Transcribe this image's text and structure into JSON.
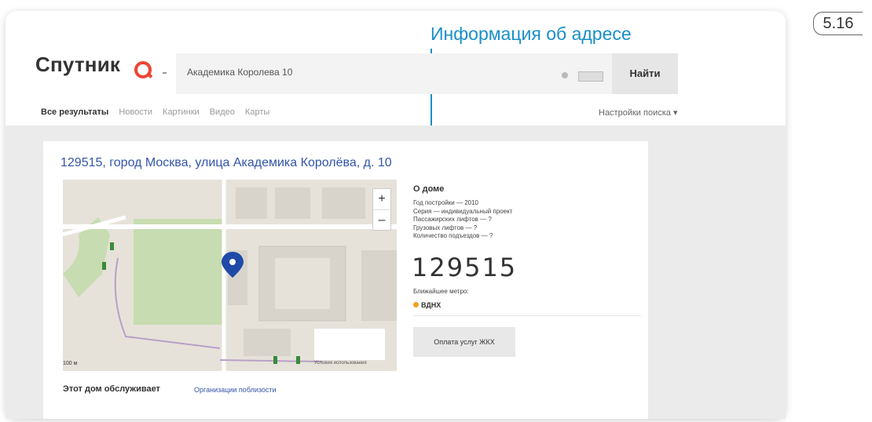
{
  "figure_number": "5.16",
  "callout": "Информация об адресе",
  "header": {
    "logo": "Спутник",
    "search_value": "Академика Королева 10",
    "search_button": "Найти"
  },
  "nav": {
    "tabs": [
      "Все результаты",
      "Новости",
      "Картинки",
      "Видео",
      "Карты"
    ],
    "settings": "Настройки поиска ▾"
  },
  "result": {
    "title": "129515, город Москва, улица Академика Королёва, д. 10",
    "map": {
      "zoom_in": "+",
      "zoom_out": "–",
      "scale": "100 м",
      "footer": "Условия использования"
    },
    "info": {
      "title": "О доме",
      "lines": [
        "Год постройки — 2010",
        "Серия — индивидуальный проект",
        "Пассажирских лифтов — ?",
        "Грузовых лифтов — ?",
        "Количество подъездов — ?"
      ],
      "zip": "129515",
      "metro_label": "Ближайшее метро:",
      "metro": "ВДНХ",
      "pay_button": "Оплата услуг ЖКХ"
    },
    "serves_label": "Этот дом обслуживает",
    "serves_link": "Организации поблизости"
  }
}
